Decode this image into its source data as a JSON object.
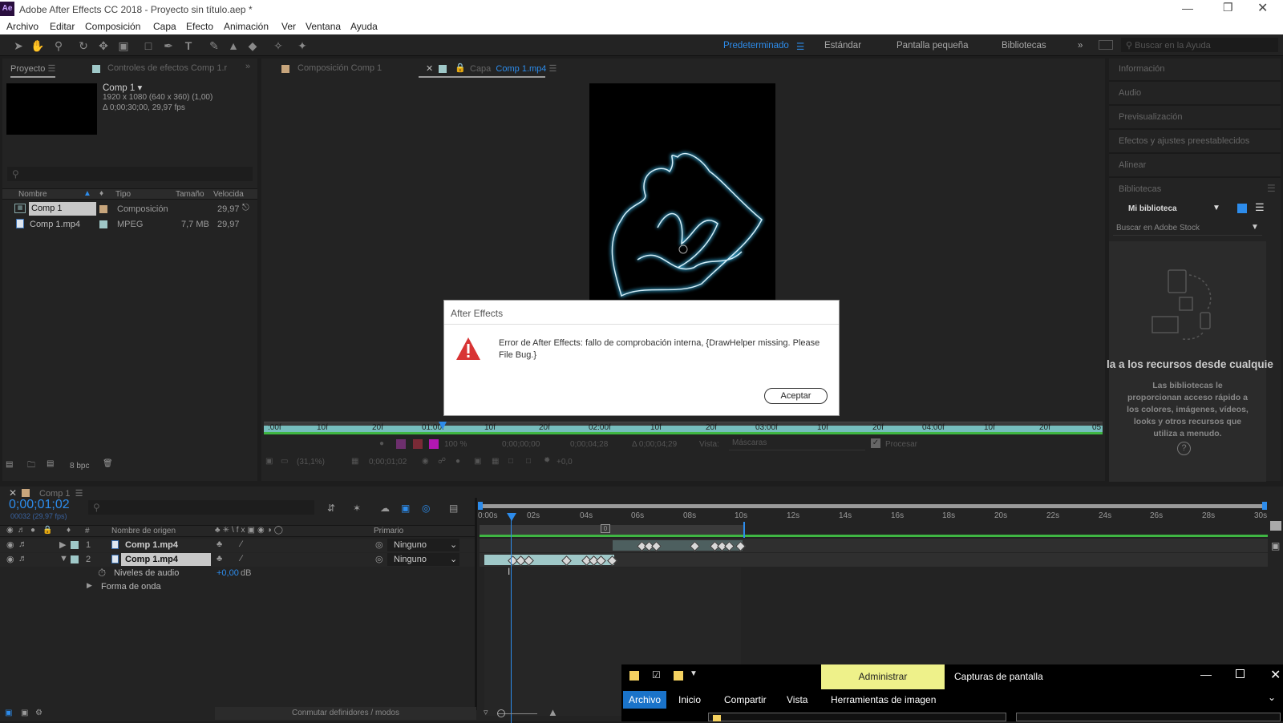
{
  "window": {
    "title": "Adobe After Effects CC 2018 - Proyecto sin título.aep *",
    "app_icon": "Ae"
  },
  "menu": [
    "Archivo",
    "Editar",
    "Composición",
    "Capa",
    "Efecto",
    "Animación",
    "Ver",
    "Ventana",
    "Ayuda"
  ],
  "workspaces": {
    "active": "Predeterminado",
    "items": [
      "Estándar",
      "Pantalla pequeña",
      "Bibliotecas"
    ],
    "help_search_placeholder": "Buscar en la Ayuda"
  },
  "project": {
    "tab": "Proyecto",
    "effects_tab": "Controles de efectos Comp 1.r",
    "comp_name": "Comp 1 ▾",
    "comp_info1": "1920 x 1080  (640 x 360) (1,00)",
    "comp_info2": "Δ 0;00;30;00, 29,97 fps",
    "columns": [
      "Nombre",
      "Tipo",
      "Tamaño",
      "Velocida"
    ],
    "items": [
      {
        "name": "Comp 1",
        "type": "Composición",
        "size": "",
        "fps": "29,97"
      },
      {
        "name": "Comp 1.mp4",
        "type": "MPEG",
        "size": "7,7 MB",
        "fps": "29,97"
      }
    ],
    "bpc": "8 bpc"
  },
  "viewer": {
    "tab_comp": "Composición  Comp 1",
    "tab_layer": "Capa",
    "tab_layer_name": "Comp 1.mp4",
    "ruler": [
      ":00f",
      "10f",
      "20f",
      "01:00f",
      "10f",
      "20f",
      "02:00f",
      "10f",
      "20f",
      "03:00f",
      "10f",
      "20f",
      "04:00f",
      "10f",
      "20f",
      "05"
    ],
    "zoom": "100 %",
    "in": "0;00;00;00",
    "out": "0;00;04;28",
    "dur": "Δ 0;00;04;29",
    "view_label": "Vista:",
    "view_value": "Máscaras",
    "render": "Procesar",
    "mag": "(31,1%)",
    "time": "0;00;01;02",
    "exposure": "+0,0"
  },
  "right": {
    "panels": [
      "Información",
      "Audio",
      "Previsualización",
      "Efectos y ajustes preestablecidos",
      "Alinear",
      "Bibliotecas"
    ],
    "library": "Mi biblioteca",
    "stock_search": "Buscar en Adobe Stock",
    "headline": "la a los recursos desde cualquie",
    "desc": "Las bibliotecas le proporcionan acceso rápido a los colores, imágenes, vídeos, looks y otros recursos que utiliza a menudo."
  },
  "timeline": {
    "tab": "Comp 1",
    "time": "0;00;01;02",
    "frames": "00032 (29,97 fps)",
    "col_source": "Nombre de origen",
    "col_num": "#",
    "col_parent": "Primario",
    "ruler": [
      "0:00s",
      "02s",
      "04s",
      "06s",
      "08s",
      "10s",
      "12s",
      "14s",
      "16s",
      "18s",
      "20s",
      "22s",
      "24s",
      "26s",
      "28s",
      "30s"
    ],
    "layers": [
      {
        "num": "1",
        "name": "Comp 1.mp4",
        "parent": "Ninguno"
      },
      {
        "num": "2",
        "name": "Comp 1.mp4",
        "parent": "Ninguno"
      }
    ],
    "audio_levels": "Niveles de audio",
    "audio_value": "+0,00",
    "audio_unit": "dB",
    "waveform": "Forma de onda",
    "toggle": "Conmutar definidores / modos"
  },
  "dialog": {
    "title": "After Effects",
    "message": "Error de After Effects: fallo de comprobación interna, {DrawHelper missing. Please File Bug.}",
    "ok": "Aceptar"
  },
  "explorer": {
    "manage": "Administrar",
    "title": "Capturas de pantalla",
    "tabs": [
      "Archivo",
      "Inicio",
      "Compartir",
      "Vista",
      "Herramientas de imagen"
    ]
  }
}
